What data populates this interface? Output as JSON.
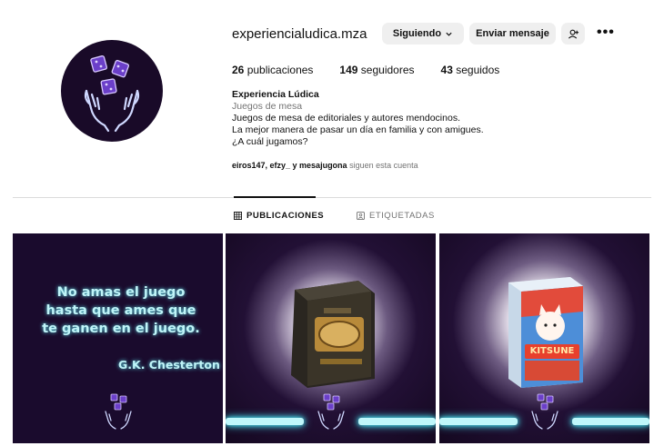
{
  "profile": {
    "username": "experiencialudica.mza",
    "follow_label": "Siguiendo",
    "message_label": "Enviar mensaje",
    "stats": [
      {
        "count": "26",
        "label": "publicaciones"
      },
      {
        "count": "149",
        "label": "seguidores"
      },
      {
        "count": "43",
        "label": "seguidos"
      }
    ],
    "bio": {
      "name": "Experiencia Lúdica",
      "category": "Juegos de mesa",
      "line1": "Juegos de mesa de editoriales y autores mendocinos.",
      "line2": "La mejor manera de pasar un día en familia y con amigues.",
      "line3": "¿A cuál jugamos?"
    },
    "followed_by": {
      "users": "eiros147, efzy_ y mesajugona",
      "suffix": " siguen esta cuenta"
    }
  },
  "tabs": {
    "posts": "PUBLICACIONES",
    "tagged": "ETIQUETADAS"
  },
  "posts": {
    "quote_l1": "No amas el juego",
    "quote_l2": "hasta que ames que",
    "quote_l3": "te ganen en el juego.",
    "quote_author": "G.K. Chesterton",
    "kitsune_title": "KITSUNE"
  },
  "colors": {
    "brand_dark": "#190a28",
    "neon": "#bff4f8",
    "dice": "#8b5cf6"
  }
}
